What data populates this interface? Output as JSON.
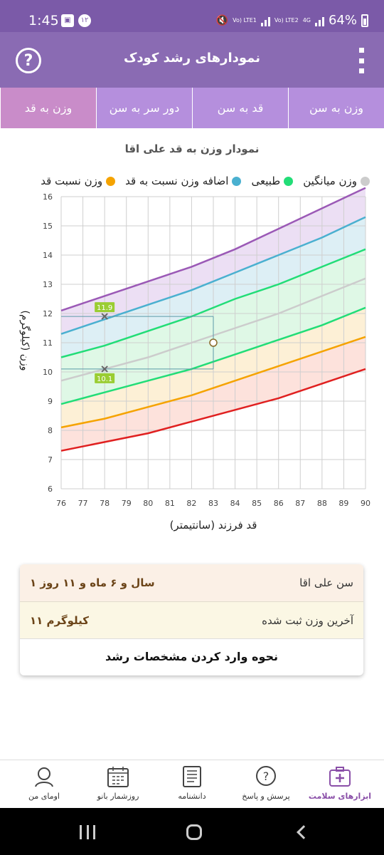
{
  "status_bar": {
    "time": "1:45",
    "notif_count": "۱۲",
    "lte1": "Vo) LTE1",
    "lte2": "Vo) LTE2",
    "net": "4G",
    "battery": "64%"
  },
  "app_bar": {
    "title": "نمودارهای رشد کودک",
    "help_label": "?"
  },
  "tabs": [
    {
      "label": "وزن به سن",
      "active": false
    },
    {
      "label": "قد به سن",
      "active": false
    },
    {
      "label": "دور سر به سن",
      "active": false
    },
    {
      "label": "وزن به قد",
      "active": true
    }
  ],
  "chart_title": "نمودار وزن به قد علی اقا",
  "legend": [
    {
      "label": "وزن میانگین",
      "color": "#cccccc"
    },
    {
      "label": "طبیعی",
      "color": "#22dd77"
    },
    {
      "label": "اضافه وزن نسبت به قد",
      "color": "#4ab0d0"
    },
    {
      "label": "وزن نسبت قد",
      "color": "#f5a300"
    }
  ],
  "chart_data": {
    "type": "line",
    "xlabel": "قد فرزند (سانتیمتر)",
    "ylabel": "وزن (کیلوگرم)",
    "xlim": [
      76,
      90
    ],
    "ylim": [
      6,
      16
    ],
    "x_ticks": [
      "76",
      "77",
      "78",
      "79",
      "80",
      "81",
      "82",
      "83",
      "84",
      "85",
      "86",
      "87",
      "88",
      "89",
      "90"
    ],
    "y_ticks": [
      "6",
      "7",
      "8",
      "9",
      "10",
      "11",
      "12",
      "13",
      "14",
      "15",
      "16"
    ],
    "x": [
      76,
      78,
      80,
      82,
      84,
      86,
      88,
      90
    ],
    "series": [
      {
        "color": "#9b59b6",
        "values": [
          12.1,
          12.6,
          13.1,
          13.6,
          14.2,
          14.9,
          15.6,
          16.3
        ]
      },
      {
        "color": "#4ab0d0",
        "values": [
          11.3,
          11.8,
          12.3,
          12.8,
          13.4,
          14.0,
          14.6,
          15.3
        ]
      },
      {
        "color": "#22dd77",
        "values": [
          10.5,
          10.9,
          11.4,
          11.9,
          12.5,
          13.0,
          13.6,
          14.2
        ]
      },
      {
        "color": "#cccccc",
        "values": [
          9.7,
          10.1,
          10.5,
          11.0,
          11.5,
          12.0,
          12.6,
          13.2
        ]
      },
      {
        "color": "#22dd77",
        "values": [
          8.9,
          9.3,
          9.7,
          10.1,
          10.6,
          11.1,
          11.6,
          12.2
        ]
      },
      {
        "color": "#f5a300",
        "values": [
          8.1,
          8.4,
          8.8,
          9.2,
          9.7,
          10.2,
          10.7,
          11.2
        ]
      },
      {
        "color": "#e02020",
        "values": [
          7.3,
          7.6,
          7.9,
          8.3,
          8.7,
          9.1,
          9.6,
          10.1
        ]
      }
    ],
    "band_fills": [
      "#ecdff4",
      "#ddeff5",
      "#dff8e6",
      "#dff8e6",
      "#fdf0d6",
      "#fde2dc"
    ],
    "markers": [
      {
        "x": 78,
        "y": 11.9,
        "label": "11.9"
      },
      {
        "x": 78,
        "y": 10.1,
        "label": "10.1"
      }
    ],
    "child_point": {
      "x": 83,
      "y": 11
    }
  },
  "info": {
    "age_label": "سن علی اقا",
    "age_value": "۱ سال و ۶ ماه و ۱۱ روز",
    "weight_label": "آخرین وزن ثبت شده",
    "weight_value": "۱۱ کیلوگرم",
    "link": "نحوه وارد کردن مشخصات رشد"
  },
  "bottom_nav": [
    {
      "label": "ابزارهای سلامت",
      "icon": "medical-kit-icon",
      "active": true
    },
    {
      "label": "پرسش و پاسخ",
      "icon": "question-bubble-icon",
      "active": false
    },
    {
      "label": "دانشنامه",
      "icon": "book-icon",
      "active": false
    },
    {
      "label": "روزشمار بانو",
      "icon": "calendar-icon",
      "active": false
    },
    {
      "label": "اومای من",
      "icon": "profile-icon",
      "active": false
    }
  ]
}
